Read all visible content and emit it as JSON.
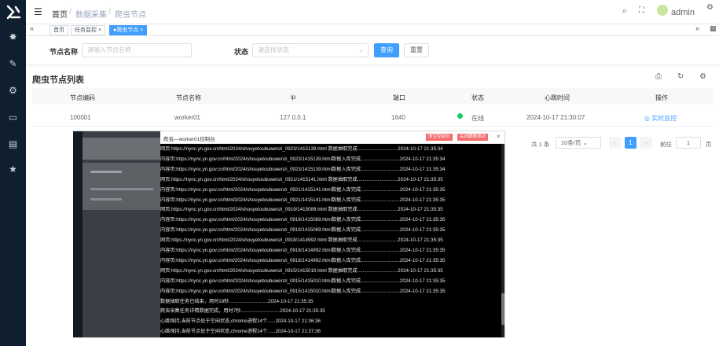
{
  "sidebar": {
    "icons": [
      "logo-icon",
      "bug-icon",
      "edit-icon",
      "gear-icon",
      "monitor-icon",
      "calendar-icon",
      "star-icon"
    ]
  },
  "navbar": {
    "breadcrumb": [
      "首页",
      "数据采集",
      "爬虫节点"
    ],
    "separator": "/",
    "user": "admin"
  },
  "tags": {
    "items": [
      "首页",
      "任务监控 ×",
      "●爬虫节点 ×"
    ]
  },
  "search": {
    "node_label": "节点名称",
    "node_placeholder": "请输入节点名称",
    "status_label": "状态",
    "status_placeholder": "请选择状态",
    "query_btn": "查询",
    "reset_btn": "重置"
  },
  "list": {
    "title": "爬虫节点列表",
    "columns": [
      "节点编码",
      "节点名称",
      "ip",
      "端口",
      "状态",
      "心跳时间",
      "操作"
    ],
    "row": {
      "code": "100001",
      "name": "worker01",
      "ip": "127.0.0.1",
      "port": "1640",
      "status": "在线",
      "heartbeat": "2024-10-17 21:30:07",
      "action": "实时监控"
    }
  },
  "pagination": {
    "total": "共 1 条",
    "size": "10条/页",
    "current": "1",
    "goto": "前往",
    "goto_value": "1",
    "unit": "页"
  },
  "console": {
    "title": "爬虫—worker01控制台",
    "btn1": "清空控制台",
    "btn2": "关闭跟随滚动",
    "close": "×",
    "lines": [
      "网页:https://nync.yn.gov.cn/html/2024/shouyetoubuwenzi_0923/1415139.html 数据抽取完成..............................2024-10-17 21:35:34",
      "内容页:https://nync.yn.gov.cn/html/2024/shouyetoubuwenzi_0923/1415139.html数据入库完成.............................2024-10-17 21:35:34",
      "内容页:https://nync.yn.gov.cn/html/2024/shouyetoubuwenzi_0923/1415139.html数据入库完成.............................2024-10-17 21:35:34",
      "网页:https://nync.yn.gov.cn/html/2024/shouyetoubuwenzi_0921/1415141.html 数据抽取完成..............................2024-10-17 21:35:35",
      "内容页:https://nync.yn.gov.cn/html/2024/shouyetoubuwenzi_0921/1415141.html数据入库完成.............................2024-10-17 21:35:35",
      "内容页:https://nync.yn.gov.cn/html/2024/shouyetoubuwenzi_0921/1415141.html数据入库完成.............................2024-10-17 21:35:35",
      "网页:https://nync.yn.gov.cn/html/2024/shouyetoubuwenzi_0919/1415089.html 数据抽取完成..............................2024-10-17 21:35:35",
      "内容页:https://nync.yn.gov.cn/html/2024/shouyetoubuwenzi_0919/1415089.html数据入库完成.............................2024-10-17 21:35:35",
      "内容页:https://nync.yn.gov.cn/html/2024/shouyetoubuwenzi_0919/1415089.html数据入库完成.............................2024-10-17 21:35:35",
      "网页:https://nync.yn.gov.cn/html/2024/shouyetoubuwenzi_0918/1414992.html 数据抽取完成..............................2024-10-17 21:35:35",
      "内容页:https://nync.yn.gov.cn/html/2024/shouyetoubuwenzi_0918/1414992.html数据入库完成.............................2024-10-17 21:35:35",
      "内容页:https://nync.yn.gov.cn/html/2024/shouyetoubuwenzi_0918/1414992.html数据入库完成.............................2024-10-17 21:35:35",
      "网页:https://nync.yn.gov.cn/html/2024/shouyetoubuwenzi_0915/1415010.html 数据抽取完成..............................2024-10-17 21:35:35",
      "内容页:https://nync.yn.gov.cn/html/2024/shouyetoubuwenzi_0915/1415010.html数据入库完成.............................2024-10-17 21:35:35",
      "内容页:https://nync.yn.gov.cn/html/2024/shouyetoubuwenzi_0915/1415010.html数据入库完成.............................2024-10-17 21:35:35",
      "数据抽取任务已结束，用时18秒.............................2024-10-17 21:35:35",
      "爬虫采集任务详情数据完成，用时7秒.............................2024-10-17 21:35:35",
      "心跳保持,当前节点处于空闲状态,chrome进程14个......2024-10-17 21:36:36",
      "心跳保持,当前节点处于空闲状态,chrome进程14个......2024-10-17 21:37:36"
    ]
  },
  "colors": {
    "primary": "#409eff",
    "sidebar": "#0f1f2f",
    "online": "#13ce66",
    "danger": "#f56c6c"
  }
}
